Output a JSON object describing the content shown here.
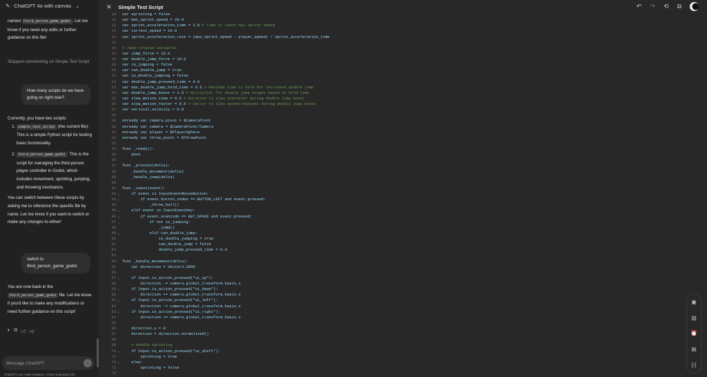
{
  "sidebar": {
    "model": "ChatGPT 4o with canvas",
    "msg1_pre": "named ",
    "msg1_code": "third_person_game_godot",
    "msg1_post": ". Let me know if you need any edits or further guidance on this file!",
    "status": "Stopped commenting on Simple Test Script",
    "user1": "How many scripts do we have going on right now?",
    "reply_intro": "Currently, you have two scripts:",
    "item1_code": "simple_test_script",
    "item1_text": " (the current file): This is a simple Python script for testing basic functionality.",
    "item2_code": "third_person_game_godot",
    "item2_text": ": This is the script for managing the third-person player controller in Godot, which includes movement, sprinting, jumping, and throwing mechanics.",
    "reply_outro": "You can switch between these scripts by asking me to reference the specific file by name. Let me know if you want to switch or make any changes to either!",
    "user2": "switch to third_person_game_godot",
    "reply2_pre": "You are now back in the ",
    "reply2_code": "third_person_game_godot",
    "reply2_post": " file. Let me know if you'd like to make any modifications or need further guidance on this script!",
    "placeholder": "Message ChatGPT",
    "footer": "ChatGPT can make mistakes. Check important info."
  },
  "editor": {
    "title": "Simple Test Script",
    "lines": [
      {
        "n": "10",
        "code": "var sprinting = false",
        "comment": ""
      },
      {
        "n": "11",
        "code": "var max_sprint_speed = 20.0",
        "comment": ""
      },
      {
        "n": "12",
        "code": "var sprint_acceleration_time = 2.0 ",
        "comment": "# Time to reach max sprint speed"
      },
      {
        "n": "13",
        "code": "var current_speed = 10.0",
        "comment": ""
      },
      {
        "n": "14",
        "code": "var sprint_acceleration_rate = (max_sprint_speed - player_speed) / sprint_acceleration_time",
        "comment": ""
      },
      {
        "n": "15",
        "code": "",
        "comment": ""
      },
      {
        "n": "16",
        "code": "",
        "comment": "# Jump-related variables"
      },
      {
        "n": "17",
        "code": "var jump_force = 15.0",
        "comment": ""
      },
      {
        "n": "18",
        "code": "var double_jump_force = 10.0",
        "comment": ""
      },
      {
        "n": "19",
        "code": "var is_jumping = false",
        "comment": ""
      },
      {
        "n": "20",
        "code": "var can_double_jump = true",
        "comment": ""
      },
      {
        "n": "21",
        "code": "var is_double_jumping = false",
        "comment": ""
      },
      {
        "n": "22",
        "code": "var double_jump_pressed_time = 0.0",
        "comment": ""
      },
      {
        "n": "23",
        "code": "var max_double_jump_hold_time = 0.5 ",
        "comment": "# Maximum time to hold for increased double jump"
      },
      {
        "n": "24",
        "code": "var double_jump_boost = 1.5 ",
        "comment": "# Multiplier for double jump height based on hold time"
      },
      {
        "n": "25",
        "code": "var slow_motion_time = 0.5 ",
        "comment": "# Duration to slow character during double jump boost"
      },
      {
        "n": "26",
        "code": "var slow_motion_factor = 0.5 ",
        "comment": "# Factor to slow ascent/descent during double jump boost"
      },
      {
        "n": "27",
        "code": "var vertical_velocity = 0.0",
        "comment": ""
      },
      {
        "n": "28",
        "code": "",
        "comment": ""
      },
      {
        "n": "29",
        "code": "onready var camera_pivot = $CameraPivot",
        "comment": ""
      },
      {
        "n": "30",
        "code": "onready var camera = $CameraPivot/Camera",
        "comment": ""
      },
      {
        "n": "31",
        "code": "onready var player = $PlayerSphere",
        "comment": ""
      },
      {
        "n": "32",
        "code": "onready var throw_point = $ThrowPoint",
        "comment": ""
      },
      {
        "n": "33",
        "code": "",
        "comment": ""
      },
      {
        "n": "34",
        "code": "func _ready():",
        "comment": ""
      },
      {
        "n": "35",
        "code": "    pass",
        "comment": ""
      },
      {
        "n": "36",
        "code": "",
        "comment": ""
      },
      {
        "n": "37",
        "code": "func _process(delta):",
        "comment": ""
      },
      {
        "n": "38",
        "code": "    _handle_movement(delta)",
        "comment": ""
      },
      {
        "n": "39",
        "code": "    _handle_jump(delta)",
        "comment": ""
      },
      {
        "n": "40",
        "code": "",
        "comment": ""
      },
      {
        "n": "41",
        "code": "func _input(event):",
        "comment": ""
      },
      {
        "n": "42",
        "fold": "⌄",
        "code": "    if event is InputEventMouseButton:",
        "comment": ""
      },
      {
        "n": "43",
        "fold": "⌄",
        "code": "        if event.button_index == BUTTON_LEFT and event.pressed:",
        "comment": ""
      },
      {
        "n": "44",
        "code": "            _throw_ball()",
        "comment": ""
      },
      {
        "n": "45",
        "fold": "⌄",
        "code": "    elif event is InputEventKey:",
        "comment": ""
      },
      {
        "n": "46",
        "fold": "⌄",
        "code": "        if event.scancode == KEY_SPACE and event.pressed:",
        "comment": ""
      },
      {
        "n": "47",
        "fold": "⌄",
        "code": "            if not is_jumping:",
        "comment": ""
      },
      {
        "n": "48",
        "code": "                _jump()",
        "comment": ""
      },
      {
        "n": "49",
        "fold": "⌄",
        "code": "            elif can_double_jump:",
        "comment": ""
      },
      {
        "n": "50",
        "code": "                is_double_jumping = true",
        "comment": ""
      },
      {
        "n": "51",
        "code": "                can_double_jump = false",
        "comment": ""
      },
      {
        "n": "52",
        "code": "                double_jump_pressed_time = 0.0",
        "comment": ""
      },
      {
        "n": "53",
        "code": "",
        "comment": ""
      },
      {
        "n": "54",
        "code": "func _handle_movement(delta):",
        "comment": ""
      },
      {
        "n": "55",
        "code": "    var direction = Vector3.ZERO",
        "comment": ""
      },
      {
        "n": "56",
        "code": "",
        "comment": ""
      },
      {
        "n": "57",
        "fold": "⌄",
        "code": "    if Input.is_action_pressed(\"ui_up\"):",
        "comment": ""
      },
      {
        "n": "58",
        "code": "        direction -= camera.global_transform.basis.z",
        "comment": ""
      },
      {
        "n": "59",
        "fold": "⌄",
        "code": "    if Input.is_action_pressed(\"ui_down\"):",
        "comment": ""
      },
      {
        "n": "60",
        "code": "        direction += camera.global_transform.basis.z",
        "comment": ""
      },
      {
        "n": "61",
        "fold": "⌄",
        "code": "    if Input.is_action_pressed(\"ui_left\"):",
        "comment": ""
      },
      {
        "n": "62",
        "code": "        direction -= camera.global_transform.basis.x",
        "comment": ""
      },
      {
        "n": "63",
        "fold": "⌄",
        "code": "    if Input.is_action_pressed(\"ui_right\"):",
        "comment": ""
      },
      {
        "n": "64",
        "code": "        direction += camera.global_transform.basis.x",
        "comment": ""
      },
      {
        "n": "65",
        "code": "",
        "comment": ""
      },
      {
        "n": "66",
        "code": "    direction.y = 0",
        "comment": ""
      },
      {
        "n": "67",
        "code": "    direction = direction.normalized()",
        "comment": ""
      },
      {
        "n": "68",
        "code": "",
        "comment": ""
      },
      {
        "n": "69",
        "code": "    ",
        "comment": "# Handle sprinting"
      },
      {
        "n": "70",
        "fold": "⌄",
        "code": "    if Input.is_action_pressed(\"ui_shift\"):",
        "comment": ""
      },
      {
        "n": "71",
        "code": "        sprinting = true",
        "comment": ""
      },
      {
        "n": "72",
        "fold": "⌄",
        "code": "    else:",
        "comment": ""
      },
      {
        "n": "73",
        "code": "        sprinting = false",
        "comment": ""
      },
      {
        "n": "74",
        "code": "",
        "comment": ""
      }
    ]
  }
}
